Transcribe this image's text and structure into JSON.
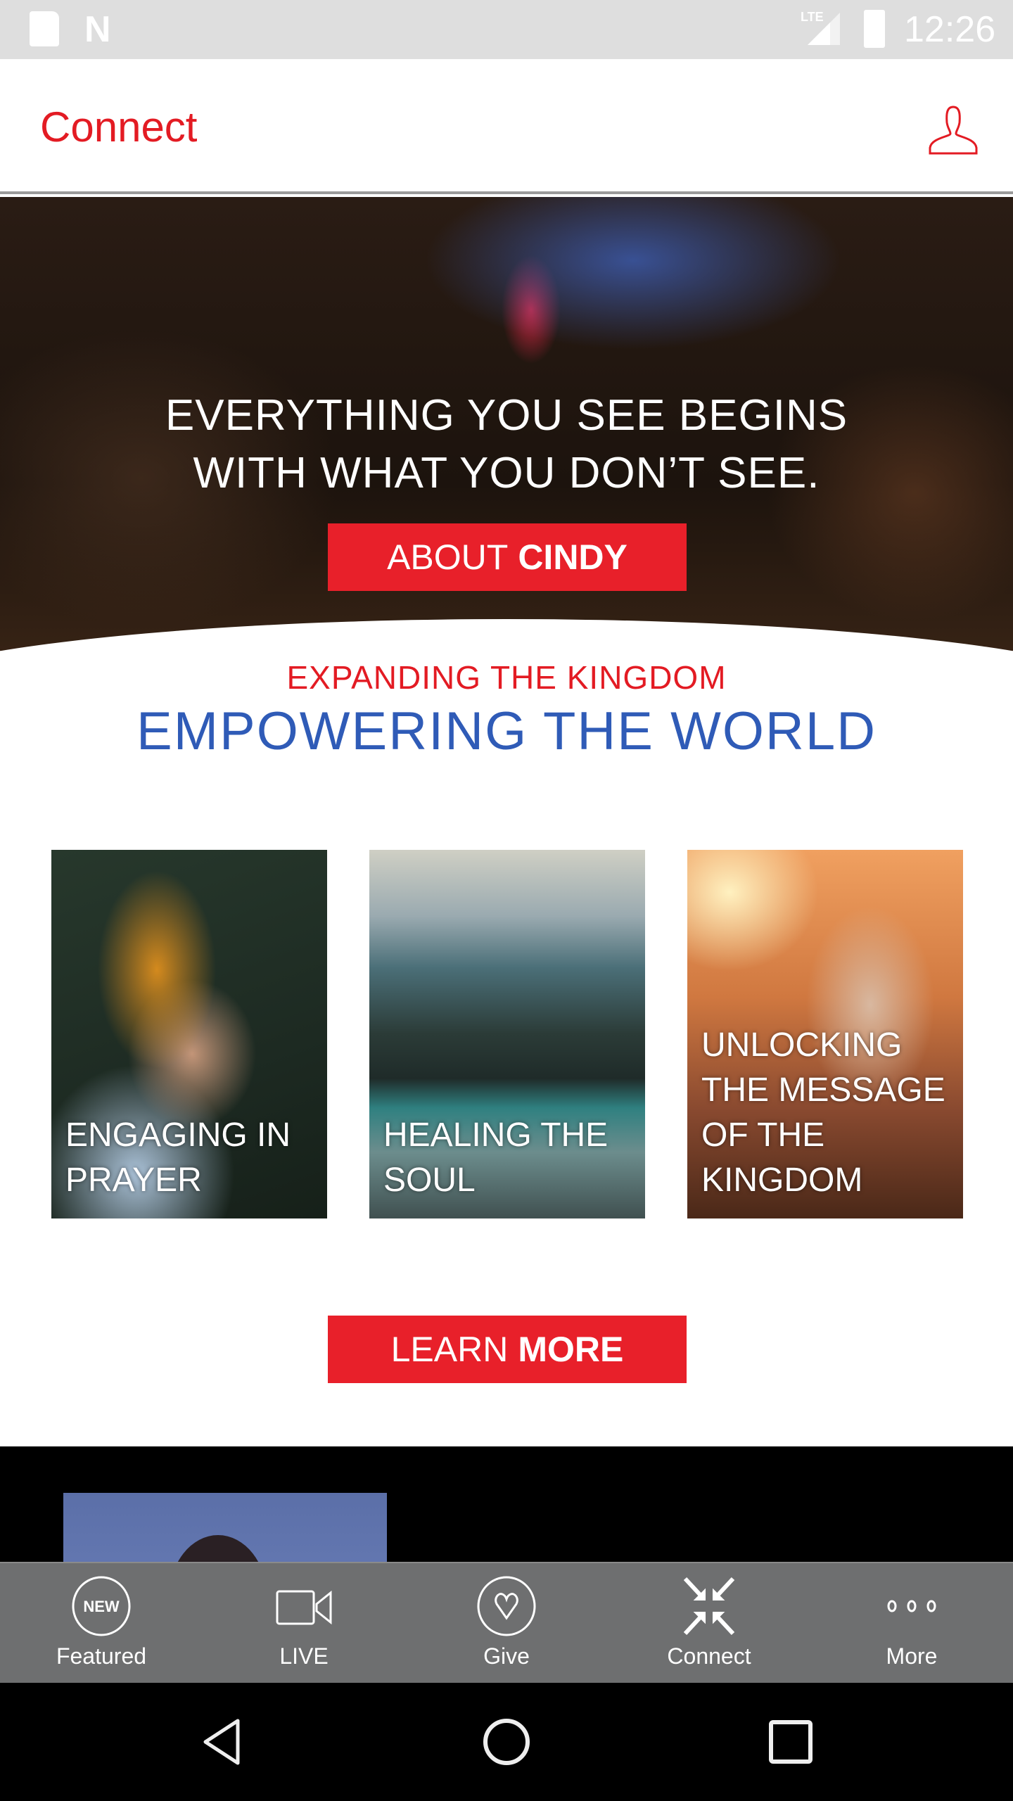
{
  "status_bar": {
    "time": "12:26",
    "network": "LTE",
    "icons": [
      "sd-card-icon",
      "n-notification-icon",
      "signal-icon",
      "battery-charging-icon"
    ]
  },
  "header": {
    "title": "Connect",
    "profile_icon": "user-profile-icon"
  },
  "hero": {
    "headline_line1": "EVERYTHING YOU SEE BEGINS",
    "headline_line2": "WITH WHAT YOU DON’T SEE.",
    "button_light": "ABOUT",
    "button_bold": "CINDY"
  },
  "tagline": {
    "top": "EXPANDING THE KINGDOM",
    "bottom": "EMPOWERING THE WORLD"
  },
  "cards": [
    {
      "label": "ENGAGING IN PRAYER"
    },
    {
      "label": "HEALING THE SOUL"
    },
    {
      "label": "UNLOCKING THE MESSAGE OF THE KINGDOM"
    }
  ],
  "learn_more": {
    "light": "LEARN",
    "bold": "MORE"
  },
  "tab_bar": {
    "tabs": [
      {
        "label": "Featured",
        "icon": "new-badge-icon",
        "badge_text": "NEW"
      },
      {
        "label": "LIVE",
        "icon": "video-camera-icon"
      },
      {
        "label": "Give",
        "icon": "heart-circle-icon"
      },
      {
        "label": "Connect",
        "icon": "collapse-arrows-icon"
      },
      {
        "label": "More",
        "icon": "more-dots-icon"
      }
    ]
  },
  "colors": {
    "brand_red": "#e31b23",
    "brand_blue": "#2f5bb7",
    "tab_bar_bg": "#6e6f70"
  }
}
